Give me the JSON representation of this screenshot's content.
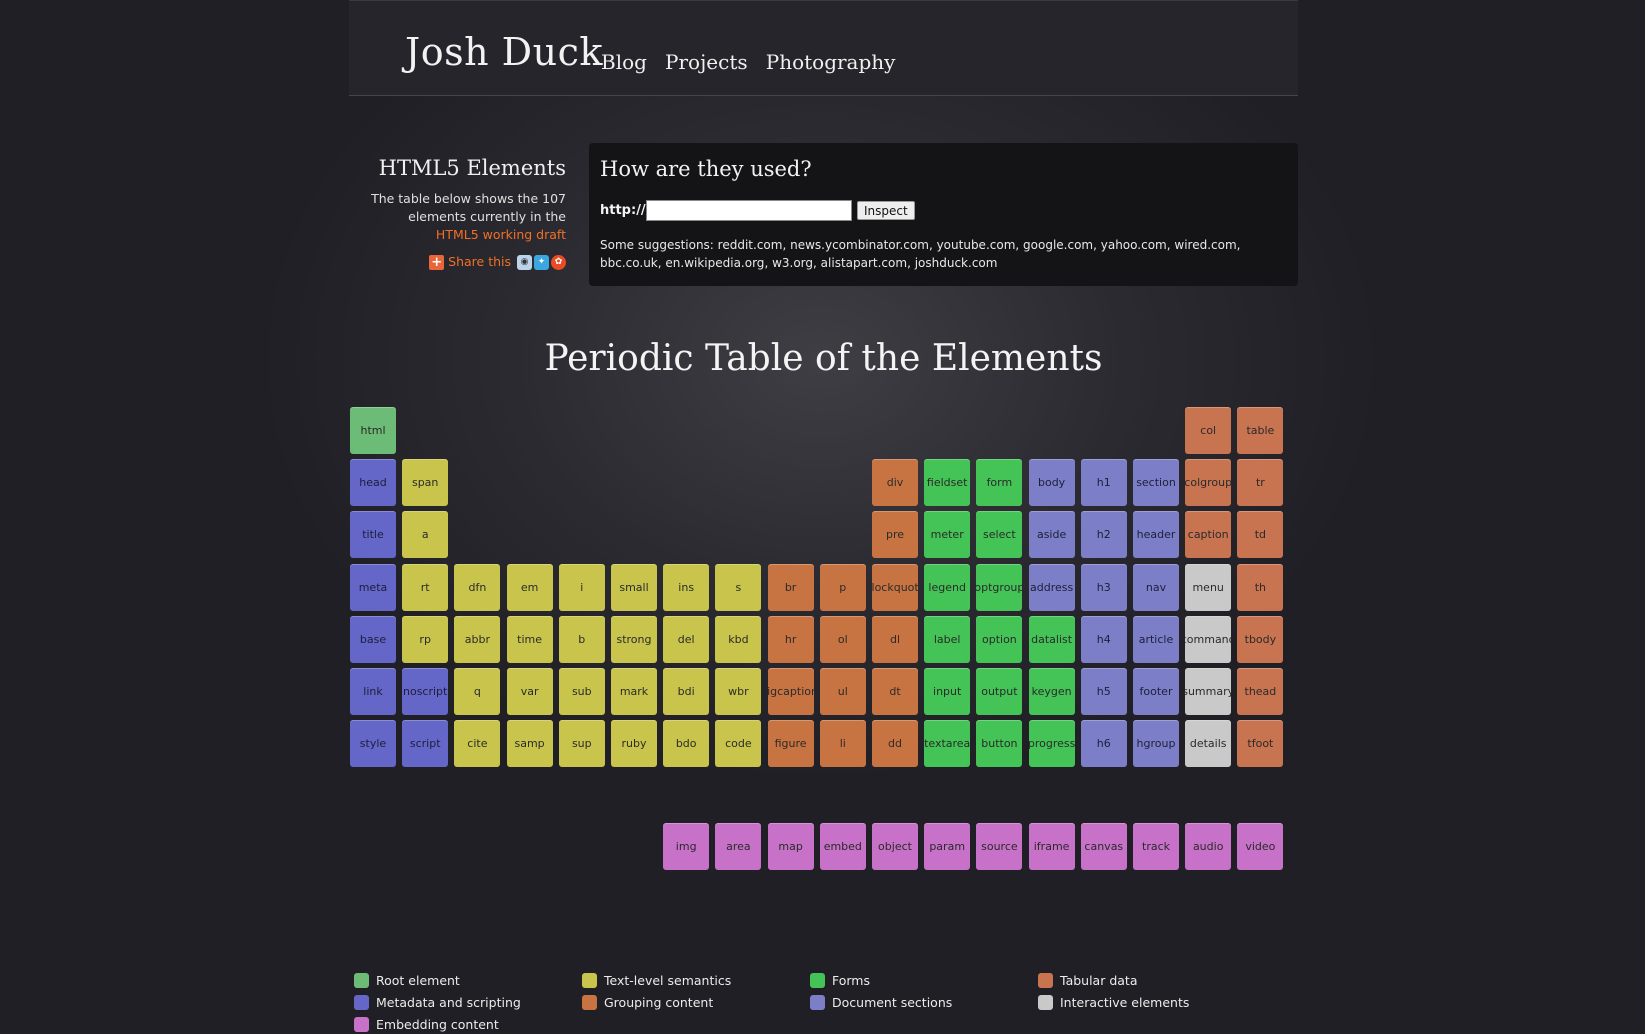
{
  "site": {
    "title": "Josh Duck",
    "nav": [
      "Blog",
      "Projects",
      "Photography"
    ]
  },
  "intro": {
    "heading": "HTML5 Elements",
    "text": "The table below shows the 107 elements currently in the",
    "draft_link": "HTML5 working draft",
    "share": "Share this"
  },
  "inspect": {
    "heading": "How are they used?",
    "http_label": "http://",
    "url_value": "",
    "button": "Inspect",
    "suggestions_label": "Some suggestions:",
    "suggestions": [
      "reddit.com",
      "news.ycombinator.com",
      "youtube.com",
      "google.com",
      "yahoo.com",
      "wired.com",
      "bbc.co.uk",
      "en.wikipedia.org",
      "w3.org",
      "alistapart.com",
      "joshduck.com"
    ]
  },
  "table": {
    "title": "Periodic Table of the Elements",
    "rows": [
      [
        [
          "html",
          "root"
        ],
        null,
        null,
        null,
        null,
        null,
        null,
        null,
        null,
        null,
        null,
        null,
        null,
        null,
        null,
        null,
        null,
        [
          "col",
          "tab"
        ],
        [
          "table",
          "tab"
        ]
      ],
      [
        [
          "head",
          "meta"
        ],
        [
          "span",
          "text"
        ],
        null,
        null,
        null,
        null,
        null,
        null,
        null,
        null,
        [
          "div",
          "group"
        ],
        [
          "fieldset",
          "forms"
        ],
        [
          "form",
          "forms"
        ],
        [
          "body",
          "sect"
        ],
        [
          "h1",
          "sect"
        ],
        [
          "section",
          "sect"
        ],
        [
          "colgroup",
          "tab"
        ],
        [
          "tr",
          "tab"
        ]
      ],
      [
        [
          "title",
          "meta"
        ],
        [
          "a",
          "text"
        ],
        null,
        null,
        null,
        null,
        null,
        null,
        null,
        null,
        [
          "pre",
          "group"
        ],
        [
          "meter",
          "forms"
        ],
        [
          "select",
          "forms"
        ],
        [
          "aside",
          "sect"
        ],
        [
          "h2",
          "sect"
        ],
        [
          "header",
          "sect"
        ],
        [
          "caption",
          "tab"
        ],
        [
          "td",
          "tab"
        ]
      ],
      [
        [
          "meta",
          "meta"
        ],
        [
          "rt",
          "text"
        ],
        [
          "dfn",
          "text"
        ],
        [
          "em",
          "text"
        ],
        [
          "i",
          "text"
        ],
        [
          "small",
          "text"
        ],
        [
          "ins",
          "text"
        ],
        [
          "s",
          "text"
        ],
        [
          "br",
          "group"
        ],
        [
          "p",
          "group"
        ],
        [
          "blockquote",
          "group"
        ],
        [
          "legend",
          "forms"
        ],
        [
          "optgroup",
          "forms"
        ],
        [
          "address",
          "sect"
        ],
        [
          "h3",
          "sect"
        ],
        [
          "nav",
          "sect"
        ],
        [
          "menu",
          "inter"
        ],
        [
          "th",
          "tab"
        ]
      ],
      [
        [
          "base",
          "meta"
        ],
        [
          "rp",
          "text"
        ],
        [
          "abbr",
          "text"
        ],
        [
          "time",
          "text"
        ],
        [
          "b",
          "text"
        ],
        [
          "strong",
          "text"
        ],
        [
          "del",
          "text"
        ],
        [
          "kbd",
          "text"
        ],
        [
          "hr",
          "group"
        ],
        [
          "ol",
          "group"
        ],
        [
          "dl",
          "group"
        ],
        [
          "label",
          "forms"
        ],
        [
          "option",
          "forms"
        ],
        [
          "datalist",
          "forms"
        ],
        [
          "h4",
          "sect"
        ],
        [
          "article",
          "sect"
        ],
        [
          "command",
          "inter"
        ],
        [
          "tbody",
          "tab"
        ]
      ],
      [
        [
          "link",
          "meta"
        ],
        [
          "noscript",
          "meta"
        ],
        [
          "q",
          "text"
        ],
        [
          "var",
          "text"
        ],
        [
          "sub",
          "text"
        ],
        [
          "mark",
          "text"
        ],
        [
          "bdi",
          "text"
        ],
        [
          "wbr",
          "text"
        ],
        [
          "figcaption",
          "group"
        ],
        [
          "ul",
          "group"
        ],
        [
          "dt",
          "group"
        ],
        [
          "input",
          "forms"
        ],
        [
          "output",
          "forms"
        ],
        [
          "keygen",
          "forms"
        ],
        [
          "h5",
          "sect"
        ],
        [
          "footer",
          "sect"
        ],
        [
          "summary",
          "inter"
        ],
        [
          "thead",
          "tab"
        ]
      ],
      [
        [
          "style",
          "meta"
        ],
        [
          "script",
          "meta"
        ],
        [
          "cite",
          "text"
        ],
        [
          "samp",
          "text"
        ],
        [
          "sup",
          "text"
        ],
        [
          "ruby",
          "text"
        ],
        [
          "bdo",
          "text"
        ],
        [
          "code",
          "text"
        ],
        [
          "figure",
          "group"
        ],
        [
          "li",
          "group"
        ],
        [
          "dd",
          "group"
        ],
        [
          "textarea",
          "forms"
        ],
        [
          "button",
          "forms"
        ],
        [
          "progress",
          "forms"
        ],
        [
          "h6",
          "sect"
        ],
        [
          "hgroup",
          "sect"
        ],
        [
          "details",
          "inter"
        ],
        [
          "tfoot",
          "tab"
        ]
      ]
    ],
    "embed_row": [
      "img",
      "area",
      "map",
      "embed",
      "object",
      "param",
      "source",
      "iframe",
      "canvas",
      "track",
      "audio",
      "video"
    ]
  },
  "legend": [
    {
      "label": "Root element",
      "color": "#6cbb77"
    },
    {
      "label": "Text-level semantics",
      "color": "#c9c54c"
    },
    {
      "label": "Forms",
      "color": "#44c457"
    },
    {
      "label": "Tabular data",
      "color": "#c87450"
    },
    {
      "label": "Metadata and scripting",
      "color": "#6466c8"
    },
    {
      "label": "Grouping content",
      "color": "#c87442"
    },
    {
      "label": "Document sections",
      "color": "#7c7fc8"
    },
    {
      "label": "Interactive elements",
      "color": "#c9c9c9"
    },
    {
      "label": "Embedding content",
      "color": "#c771c8"
    }
  ]
}
